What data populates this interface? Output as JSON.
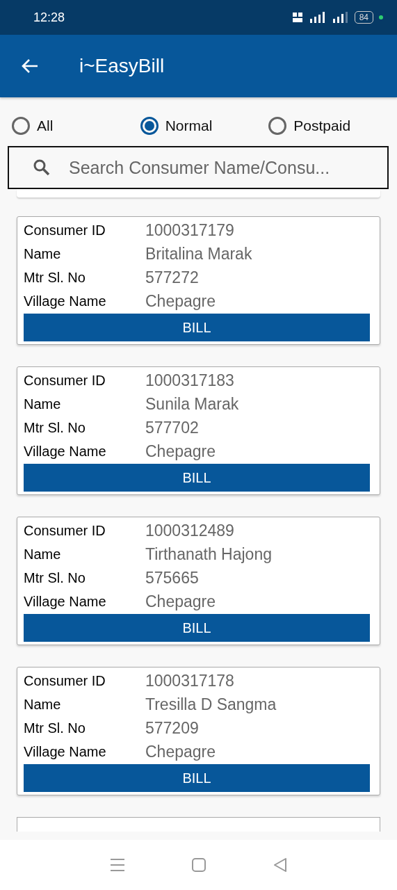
{
  "status_bar": {
    "time": "12:28",
    "battery": "84"
  },
  "app_bar": {
    "title": "i~EasyBill"
  },
  "filters": [
    {
      "label": "All",
      "selected": false
    },
    {
      "label": "Normal",
      "selected": true
    },
    {
      "label": "Postpaid",
      "selected": false
    }
  ],
  "search": {
    "placeholder": "Search Consumer Name/Consu..."
  },
  "consumers": [
    {
      "fields": [
        {
          "label": "Consumer ID",
          "value": "1000317179"
        },
        {
          "label": "Name",
          "value": "Britalina Marak"
        },
        {
          "label": "Mtr Sl. No",
          "value": "577272"
        },
        {
          "label": "Village Name",
          "value": "Chepagre"
        }
      ],
      "button": "BILL"
    },
    {
      "fields": [
        {
          "label": "Consumer ID",
          "value": "1000317183"
        },
        {
          "label": "Name",
          "value": "Sunila Marak"
        },
        {
          "label": "Mtr Sl. No",
          "value": "577702"
        },
        {
          "label": "Village Name",
          "value": "Chepagre"
        }
      ],
      "button": "BILL"
    },
    {
      "fields": [
        {
          "label": "Consumer ID",
          "value": "1000312489"
        },
        {
          "label": "Name",
          "value": "Tirthanath Hajong"
        },
        {
          "label": "Mtr Sl. No",
          "value": "575665"
        },
        {
          "label": "Village Name",
          "value": "Chepagre"
        }
      ],
      "button": "BILL"
    },
    {
      "fields": [
        {
          "label": "Consumer ID",
          "value": "1000317178"
        },
        {
          "label": "Name",
          "value": "Tresilla D Sangma"
        },
        {
          "label": "Mtr Sl. No",
          "value": "577209"
        },
        {
          "label": "Village Name",
          "value": "Chepagre"
        }
      ],
      "button": "BILL"
    }
  ]
}
